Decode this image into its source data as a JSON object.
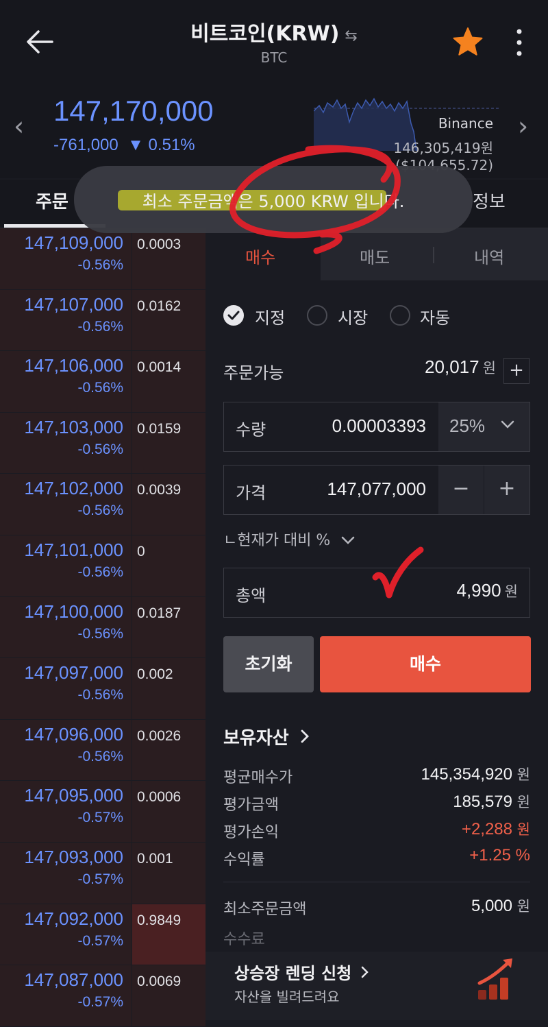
{
  "header": {
    "title": "비트코인(KRW)",
    "swap_glyph": "⇆",
    "subtitle": "BTC",
    "back_icon": "arrow-left-icon",
    "favorite_icon": "star-icon",
    "favorite_color": "#f5821f",
    "more_icon": "more-vertical-icon"
  },
  "ticker": {
    "price": "147,170,000",
    "change": "-761,000",
    "change_pct": "▼ 0.51%",
    "exchange": "Binance",
    "exchange_price": "146,305,419원($104,655.72)",
    "color_down": "#6b92ff"
  },
  "tabs": {
    "left": "주문",
    "right": "정보"
  },
  "toast": {
    "message": "최소 주문금액은 5,000 KRW 입니다."
  },
  "orderbook": [
    {
      "price": "147,109,000",
      "pct": "-0.56%",
      "qty": "0.0003"
    },
    {
      "price": "147,107,000",
      "pct": "-0.56%",
      "qty": "0.0162"
    },
    {
      "price": "147,106,000",
      "pct": "-0.56%",
      "qty": "0.0014"
    },
    {
      "price": "147,103,000",
      "pct": "-0.56%",
      "qty": "0.0159"
    },
    {
      "price": "147,102,000",
      "pct": "-0.56%",
      "qty": "0.0039"
    },
    {
      "price": "147,101,000",
      "pct": "-0.56%",
      "qty": "0"
    },
    {
      "price": "147,100,000",
      "pct": "-0.56%",
      "qty": "0.0187"
    },
    {
      "price": "147,097,000",
      "pct": "-0.56%",
      "qty": "0.002"
    },
    {
      "price": "147,096,000",
      "pct": "-0.56%",
      "qty": "0.0026"
    },
    {
      "price": "147,095,000",
      "pct": "-0.57%",
      "qty": "0.0006"
    },
    {
      "price": "147,093,000",
      "pct": "-0.57%",
      "qty": "0.001"
    },
    {
      "price": "147,092,000",
      "pct": "-0.57%",
      "qty": "0.9849"
    },
    {
      "price": "147,087,000",
      "pct": "-0.57%",
      "qty": "0.0069"
    }
  ],
  "order": {
    "side_tabs": {
      "buy": "매수",
      "sell": "매도",
      "history": "내역"
    },
    "types": {
      "limit": "지정",
      "market": "시장",
      "auto": "자동"
    },
    "available_label": "주문가능",
    "available_value": "20,017",
    "won": "원",
    "quantity_label": "수량",
    "quantity_value": "0.00003393",
    "pct_select": "25%",
    "price_label": "가격",
    "price_value": "147,077,000",
    "minus": "−",
    "plus": "+",
    "compare_label": "현재가 대비 %",
    "total_label": "총액",
    "total_value": "4,990",
    "reset_label": "초기화",
    "buy_label": "매수",
    "buy_color": "#e8543f"
  },
  "holdings": {
    "title": "보유자산",
    "avg_label": "평균매수가",
    "avg_value": "145,354,920",
    "eval_label": "평가금액",
    "eval_value": "185,579",
    "pnl_label": "평가손익",
    "pnl_value": "+2,288",
    "roi_label": "수익률",
    "roi_value": "+1.25 %",
    "min_label": "최소주문금액",
    "min_value": "5,000",
    "fee_label": "수수료"
  },
  "banner": {
    "title": "상승장 렌딩 신청",
    "subtitle": "자산을 빌려드려요"
  },
  "annotations": {
    "ink_color": "#e0202a"
  }
}
